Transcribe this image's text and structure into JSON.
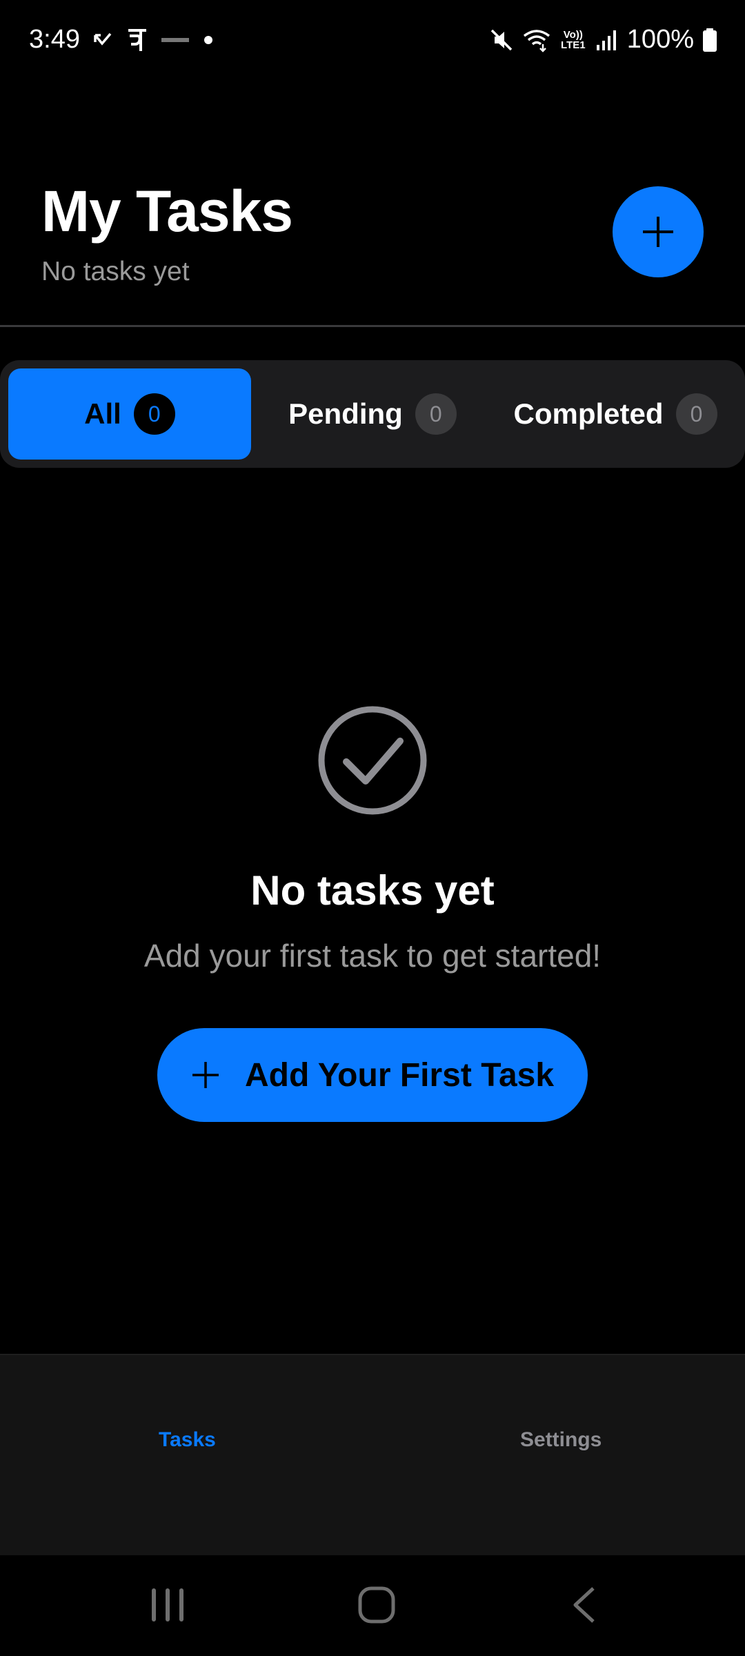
{
  "status_bar": {
    "time": "3:49",
    "battery": "100%",
    "network_label": "Vo)) LTE1",
    "left_icons": [
      "missed-call-icon",
      "phonepe-icon",
      "bhim-icon",
      "notification-dot-icon"
    ],
    "right_icons": [
      "mute-icon",
      "wifi-icon",
      "signal-icon",
      "battery-icon"
    ]
  },
  "header": {
    "title": "My Tasks",
    "subtitle": "No tasks yet",
    "add_button_icon": "plus-icon"
  },
  "tabs": [
    {
      "label": "All",
      "count": "0",
      "active": true
    },
    {
      "label": "Pending",
      "count": "0",
      "active": false
    },
    {
      "label": "Completed",
      "count": "0",
      "active": false
    }
  ],
  "empty_state": {
    "icon": "check-circle-icon",
    "title": "No tasks yet",
    "subtitle": "Add your first task to get started!",
    "cta_label": "Add Your First Task",
    "cta_icon": "plus-icon"
  },
  "bottom_nav": {
    "items": [
      {
        "label": "Tasks",
        "active": true
      },
      {
        "label": "Settings",
        "active": false
      }
    ]
  },
  "system_nav": [
    "recents-icon",
    "home-icon",
    "back-icon"
  ],
  "colors": {
    "accent": "#0a7aff",
    "background": "#000000",
    "surface": "#1c1c1e",
    "muted_text": "#9a9a9a"
  }
}
